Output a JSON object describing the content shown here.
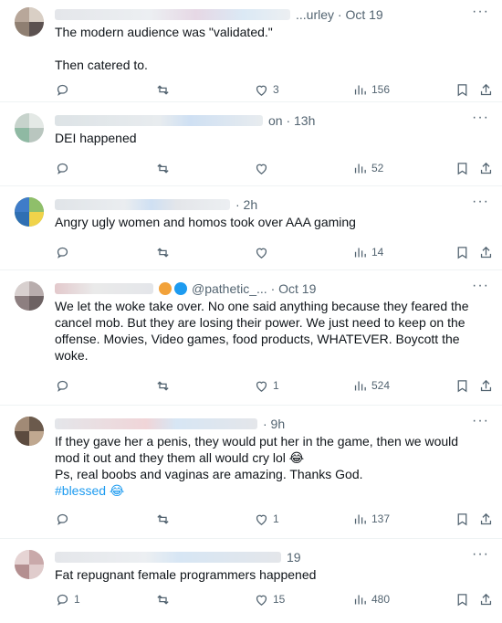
{
  "colors": {
    "text": "#0f1419",
    "meta": "#536471",
    "hashtag": "#1d9bf0",
    "divider": "#eff3f4"
  },
  "icons": {
    "reply": "speech-bubble-icon",
    "retweet": "retweet-arrows-icon",
    "like": "heart-icon",
    "views": "bar-chart-icon",
    "bookmark": "bookmark-icon",
    "share": "share-upload-icon",
    "more": "more-dots-icon"
  },
  "more_glyph": "···",
  "posts": [
    {
      "meta": "...urley · Oct 19",
      "lines": [
        "The modern audience was \"validated.\"",
        "",
        "Then catered to."
      ],
      "replies": "",
      "retweets": "",
      "likes": "3",
      "views": "156"
    },
    {
      "meta": "on · 13h",
      "lines": [
        "DEI happened"
      ],
      "replies": "",
      "retweets": "",
      "likes": "",
      "views": "52"
    },
    {
      "meta": "· 2h",
      "lines": [
        "Angry ugly women and homos took over AAA gaming"
      ],
      "replies": "",
      "retweets": "",
      "likes": "",
      "views": "14"
    },
    {
      "meta": "@pathetic_... · Oct 19",
      "lines": [
        "We let the woke take over. No one said anything because they feared the",
        "cancel mob. But they are losing their power. We just need to keep on the",
        "offense. Movies, Video games, food products, WHATEVER. Boycott the",
        "woke."
      ],
      "replies": "",
      "retweets": "",
      "likes": "1",
      "views": "524"
    },
    {
      "meta": "· 9h",
      "lines": [
        "If they gave her a penis, they would put her in the game, then we would",
        "mod it out and they them all would cry lol 😂",
        "Ps, real boobs and vaginas are amazing. Thanks God."
      ],
      "hashtag": "#blessed 😂",
      "replies": "",
      "retweets": "",
      "likes": "1",
      "views": "137"
    },
    {
      "meta": "19",
      "lines": [
        "Fat repugnant female programmers happened"
      ],
      "replies": "1",
      "retweets": "",
      "likes": "15",
      "views": "480"
    }
  ]
}
